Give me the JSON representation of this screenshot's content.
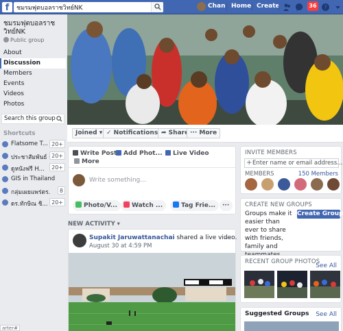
{
  "topbar": {
    "search_value": "ชมรมฟุตบอลราชวิทย์NK",
    "user_name": "Chan",
    "home_label": "Home",
    "create_label": "Create",
    "notification_count": "36"
  },
  "group": {
    "name": "ชมรมฟุตบอลราชวิทย์NK",
    "privacy": "Public group"
  },
  "nav": [
    {
      "label": "About"
    },
    {
      "label": "Discussion"
    },
    {
      "label": "Members"
    },
    {
      "label": "Events"
    },
    {
      "label": "Videos"
    },
    {
      "label": "Photos"
    }
  ],
  "left_search_placeholder": "Search this group",
  "shortcuts": {
    "title": "Shortcuts",
    "items": [
      {
        "label": "Flatsome T...",
        "count": "20+"
      },
      {
        "label": "ประชาสัมพันธ์ รา...",
        "count": "20+"
      },
      {
        "label": "ดูหนังฟรี H...",
        "count": "20+"
      },
      {
        "label": "GIS in Thailand",
        "count": ""
      },
      {
        "label": "กลุ่มเผยแพร่ตร...",
        "count": "8"
      },
      {
        "label": "ดร.ทักษิณ ชิ...",
        "count": "20+"
      }
    ]
  },
  "actions": {
    "joined": "Joined ▾",
    "notifications": "✓ Notifications",
    "share": "➦ Share",
    "more": "··· More"
  },
  "composer": {
    "tabs": [
      "Write Post",
      "Add Phot...",
      "Live Video",
      "More"
    ],
    "placeholder": "Write something...",
    "pills": [
      "Photo/V...",
      "Watch ...",
      "Tag Frie...",
      "···"
    ]
  },
  "new_activity": "NEW ACTIVITY ▾",
  "post": {
    "author": "Supakit Jaruwattanachai",
    "action": " shared a live video.",
    "date": "August 30 at 4:59 PM",
    "menu": "···"
  },
  "invite": {
    "title": "INVITE MEMBERS",
    "placeholder": "Enter name or email address...",
    "members_label": "MEMBERS",
    "members_count": "150 Members"
  },
  "create_group": {
    "title": "CREATE NEW GROUPS",
    "text": "Groups make it easier than ever to share with friends, family and teammates.",
    "button": "Create Group"
  },
  "recent_photos": {
    "title": "RECENT GROUP PHOTOS",
    "see_all": "See All"
  },
  "suggested": {
    "title": "Suggested Groups",
    "see_all": "See All"
  },
  "bottom_tag": "arter#",
  "colors": {
    "brand": "#4267b2",
    "link": "#365899",
    "badge": "#fa3e3e",
    "background": "#e9ebee"
  }
}
